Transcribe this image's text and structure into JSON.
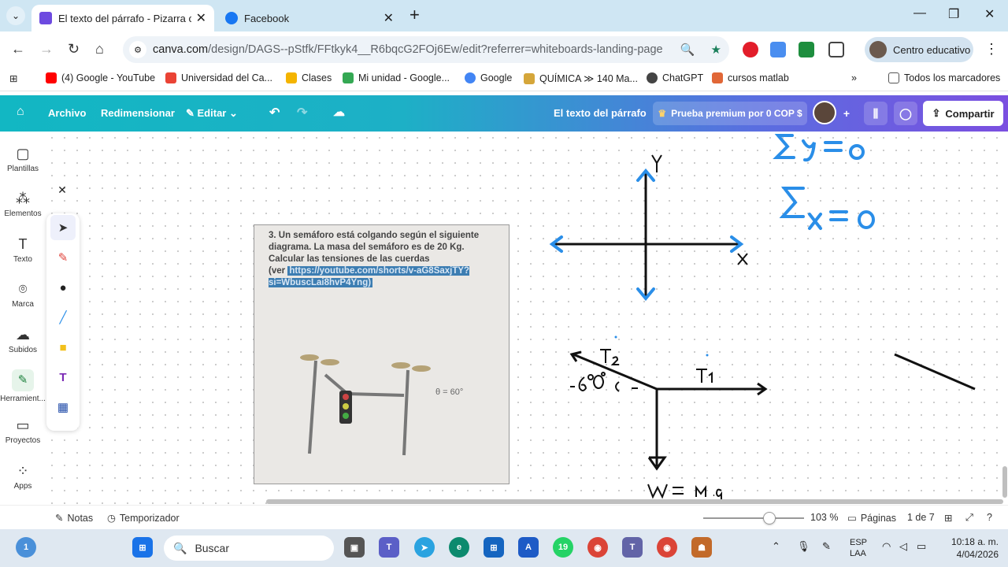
{
  "browser": {
    "tabs": [
      {
        "title": "El texto del párrafo - Pizarra onl",
        "active": true
      },
      {
        "title": "Facebook",
        "active": false
      }
    ],
    "url_host": "canva.com",
    "url_path": "/design/DAGS--pStfk/FFtkyk4__R6bqcG2FOj6Ew/edit?referrer=whiteboards-landing-page",
    "profile_label": "Centro educativo",
    "bookmarks": [
      "(4) Google - YouTube",
      "Universidad del Ca...",
      "Clases",
      "Mi unidad - Google...",
      "Google",
      "QUÍMICA ≫ 140 Ma...",
      "ChatGPT",
      "cursos matlab"
    ],
    "all_bookmarks": "Todos los marcadores"
  },
  "canva": {
    "menu": {
      "file": "Archivo",
      "resize": "Redimensionar",
      "edit": "Editar"
    },
    "doc_title": "El texto del párrafo",
    "premium": "Prueba premium por 0 COP $",
    "share": "Compartir",
    "rail": [
      {
        "label": "Plantillas",
        "icon": "templates-icon"
      },
      {
        "label": "Elementos",
        "icon": "elements-icon"
      },
      {
        "label": "Texto",
        "icon": "text-icon"
      },
      {
        "label": "Marca",
        "icon": "brand-icon"
      },
      {
        "label": "Subidos",
        "icon": "uploads-icon"
      },
      {
        "label": "Herramient...",
        "icon": "draw-tools-icon"
      },
      {
        "label": "Proyectos",
        "icon": "projects-icon"
      },
      {
        "label": "Apps",
        "icon": "apps-icon"
      }
    ],
    "problem": {
      "text": "3. Un semáforo está colgando según el siguiente diagrama. La masa del semáforo es de 20 Kg. Calcular las tensiones de las cuerdas",
      "ver": "(ver",
      "link": "https://youtube.com/shorts/v-aG8SaxjTY?si=WbuscLai8hvP4Yng)",
      "theta": "θ = 60°"
    },
    "status": {
      "notes": "Notas",
      "timer": "Temporizador",
      "zoom": "103 %",
      "pages_label": "Páginas",
      "pages": "1 de 7",
      "zoom_level": 0.66
    }
  },
  "taskbar": {
    "search": "Buscar",
    "lang": "ESP",
    "layout": "LAA",
    "time": "10:18 a. m.",
    "date": "4/04/2026",
    "notif_weather": "1",
    "notif_whatsapp": "19"
  }
}
